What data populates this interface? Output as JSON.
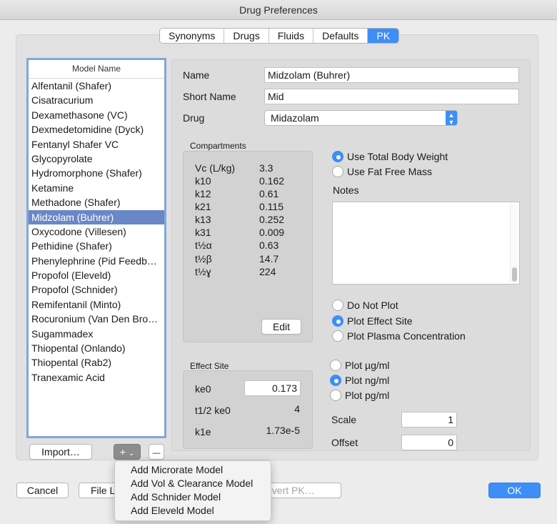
{
  "window": {
    "title": "Drug Preferences"
  },
  "tabs": [
    {
      "label": "Synonyms",
      "active": false
    },
    {
      "label": "Drugs",
      "active": false
    },
    {
      "label": "Fluids",
      "active": false
    },
    {
      "label": "Defaults",
      "active": false
    },
    {
      "label": "PK",
      "active": true
    }
  ],
  "model_list": {
    "header": "Model Name",
    "selected": "Midzolam (Buhrer)",
    "items": [
      "Alfentanil (Shafer)",
      "Cisatracurium",
      "Dexamethasone (VC)",
      "Dexmedetomidine (Dyck)",
      "Fentanyl Shafer VC",
      "Glycopyrolate",
      "Hydromorphone (Shafer)",
      "Ketamine",
      "Methadone (Shafer)",
      "Midzolam (Buhrer)",
      "Oxycodone (Villesen)",
      "Pethidine (Shafer)",
      "Phenylephrine (Pid Feedb…",
      "Propofol (Eleveld)",
      "Propofol (Schnider)",
      "Remifentanil (Minto)",
      "Rocuronium (Van Den Bro…",
      "Sugammadex",
      "Thiopental (Onlando)",
      "Thiopental (Rab2)",
      "Tranexamic Acid"
    ]
  },
  "list_buttons": {
    "import": "Import…",
    "add": "+",
    "add_chevron": "⌄",
    "remove": "—"
  },
  "form": {
    "name_label": "Name",
    "name_value": "Midzolam (Buhrer)",
    "short_name_label": "Short Name",
    "short_name_value": "Mid",
    "drug_label": "Drug",
    "drug_value": "Midazolam"
  },
  "compartments": {
    "title": "Compartments",
    "rows": [
      {
        "label": "Vc (L/kg)",
        "value": "3.3"
      },
      {
        "label": "k10",
        "value": "0.162"
      },
      {
        "label": "k12",
        "value": "0.61"
      },
      {
        "label": "k21",
        "value": "0.115"
      },
      {
        "label": "k13",
        "value": "0.252"
      },
      {
        "label": "k31",
        "value": "0.009"
      },
      {
        "label": "t½α",
        "value": "0.63"
      },
      {
        "label": "t½β",
        "value": "14.7"
      },
      {
        "label": "t½ɣ",
        "value": "224"
      }
    ],
    "edit_button": "Edit"
  },
  "weight_options": [
    {
      "label": "Use Total Body Weight",
      "selected": true
    },
    {
      "label": "Use Fat Free Mass",
      "selected": false
    }
  ],
  "notes": {
    "label": "Notes",
    "value": ""
  },
  "plot_options": [
    {
      "label": "Do Not Plot",
      "selected": false
    },
    {
      "label": "Plot Effect Site",
      "selected": true
    },
    {
      "label": "Plot Plasma Concentration",
      "selected": false
    }
  ],
  "effect_site": {
    "title": "Effect Site",
    "ke0_label": "ke0",
    "ke0_value": "0.173",
    "t12_label": "t1/2 ke0",
    "t12_value": "4",
    "k1e_label": "k1e",
    "k1e_value": "1.73e-5"
  },
  "unit_options": [
    {
      "label": "Plot µg/ml",
      "selected": false
    },
    {
      "label": "Plot ng/ml",
      "selected": true
    },
    {
      "label": "Plot pg/ml",
      "selected": false
    }
  ],
  "scale": {
    "label": "Scale",
    "value": "1"
  },
  "offset": {
    "label": "Offset",
    "value": "0"
  },
  "popup_menu": [
    "Add Microrate Model",
    "Add Vol & Clearance Model",
    "Add Schnider Model",
    "Add Eleveld Model"
  ],
  "footer": {
    "cancel": "Cancel",
    "file": "File L",
    "revert": "evert PK…",
    "ok": "OK"
  },
  "colors": {
    "accent": "#3d8ef6",
    "selection": "#6a87c7"
  }
}
